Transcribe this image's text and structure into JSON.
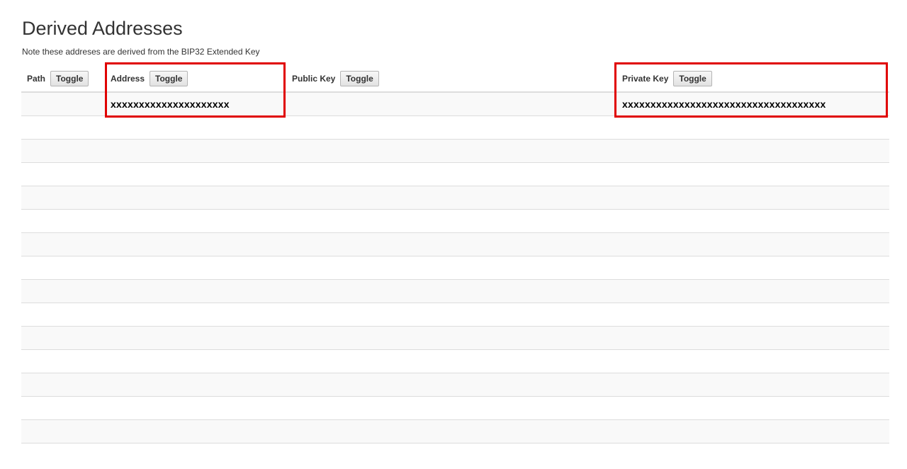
{
  "section": {
    "title": "Derived Addresses",
    "note": "Note these addreses are derived from the BIP32 Extended Key"
  },
  "table": {
    "columns": [
      {
        "label": "Path",
        "toggle": "Toggle"
      },
      {
        "label": "Address",
        "toggle": "Toggle"
      },
      {
        "label": "Public Key",
        "toggle": "Toggle"
      },
      {
        "label": "Private Key",
        "toggle": "Toggle"
      }
    ],
    "rows": [
      {
        "path": "",
        "address": "xxxxxxxxxxxxxxxxxxxxx",
        "pubkey": "",
        "privkey": "xxxxxxxxxxxxxxxxxxxxxxxxxxxxxxxxxxxx"
      },
      {
        "path": "",
        "address": "",
        "pubkey": "",
        "privkey": ""
      },
      {
        "path": "",
        "address": "",
        "pubkey": "",
        "privkey": ""
      },
      {
        "path": "",
        "address": "",
        "pubkey": "",
        "privkey": ""
      },
      {
        "path": "",
        "address": "",
        "pubkey": "",
        "privkey": ""
      },
      {
        "path": "",
        "address": "",
        "pubkey": "",
        "privkey": ""
      },
      {
        "path": "",
        "address": "",
        "pubkey": "",
        "privkey": ""
      },
      {
        "path": "",
        "address": "",
        "pubkey": "",
        "privkey": ""
      },
      {
        "path": "",
        "address": "",
        "pubkey": "",
        "privkey": ""
      },
      {
        "path": "",
        "address": "",
        "pubkey": "",
        "privkey": ""
      },
      {
        "path": "",
        "address": "",
        "pubkey": "",
        "privkey": ""
      },
      {
        "path": "",
        "address": "",
        "pubkey": "",
        "privkey": ""
      },
      {
        "path": "",
        "address": "",
        "pubkey": "",
        "privkey": ""
      },
      {
        "path": "",
        "address": "",
        "pubkey": "",
        "privkey": ""
      },
      {
        "path": "",
        "address": "",
        "pubkey": "",
        "privkey": ""
      }
    ]
  },
  "annotations": {
    "highlight_color": "#e00000"
  }
}
